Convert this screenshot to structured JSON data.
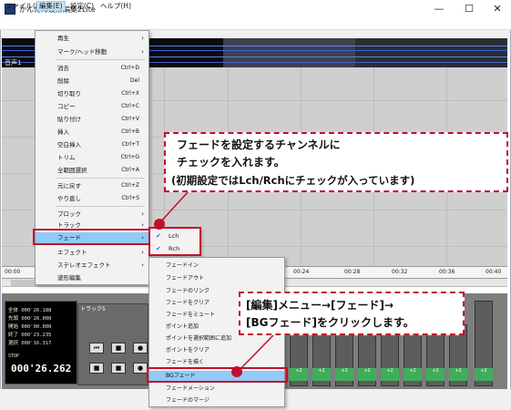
{
  "window": {
    "title": "かんたん波形編集2Lite",
    "min": "—",
    "max": "☐",
    "close": "✕"
  },
  "menubar": [
    "ファイル(F)",
    "編集(E)",
    "設定(C)",
    "ヘルプ(H)"
  ],
  "track_label_upper": "音声1",
  "edit_menu": [
    {
      "label": "再生",
      "shortcut": "",
      "submenu": true
    },
    {
      "label": "マーク/ヘッド移動",
      "shortcut": "",
      "submenu": true
    },
    {
      "label": "消去",
      "shortcut": "Ctrl+D"
    },
    {
      "label": "削除",
      "shortcut": "Del"
    },
    {
      "label": "切り取り",
      "shortcut": "Ctrl+X"
    },
    {
      "label": "コピー",
      "shortcut": "Ctrl+C"
    },
    {
      "label": "貼り付け",
      "shortcut": "Ctrl+V"
    },
    {
      "label": "挿入",
      "shortcut": "Ctrl+B"
    },
    {
      "label": "空白挿入",
      "shortcut": "Ctrl+T"
    },
    {
      "label": "トリム",
      "shortcut": "Ctrl+G"
    },
    {
      "label": "全範囲選択",
      "shortcut": "Ctrl+A"
    },
    {
      "label": "元に戻す",
      "shortcut": "Ctrl+Z"
    },
    {
      "label": "やり直し",
      "shortcut": "Ctrl+S"
    },
    {
      "label": "ブロック",
      "shortcut": "",
      "submenu": true
    },
    {
      "label": "トラック",
      "shortcut": "",
      "submenu": true
    },
    {
      "label": "フェード",
      "shortcut": "",
      "submenu": true
    },
    {
      "label": "エフェクト",
      "shortcut": "",
      "submenu": true
    },
    {
      "label": "ステレオエフェクト",
      "shortcut": "",
      "submenu": true
    },
    {
      "label": "波形編集",
      "shortcut": ""
    }
  ],
  "channel_menu": [
    "Lch",
    "Rch"
  ],
  "fade_menu": [
    "フェードイン",
    "フェードアウト",
    "フェードのリンク",
    "フェードをクリア",
    "フェードをミュート",
    "ポイント追加",
    "ポイントを選択範囲に追加",
    "ポイントをクリア",
    "フェードを描く",
    "BGフェード",
    "フェードメーション",
    "フェードのマージ"
  ],
  "ruler_ticks": [
    "00:00",
    "00:24",
    "00:28",
    "00:32",
    "00:36",
    "00:40"
  ],
  "time_panel": {
    "lines": [
      {
        "k": "全体",
        "v": "000'26.188"
      },
      {
        "k": "先頭",
        "v": "000'26.000"
      },
      {
        "k": "開始",
        "v": "000'00.000"
      },
      {
        "k": "終了",
        "v": "000'23.235"
      },
      {
        "k": "選択",
        "v": "000'16.317"
      }
    ],
    "state": "STOP",
    "current": "000'26.262"
  },
  "track_panel_label": "トラック5",
  "mixer_label": "+2",
  "callout1": {
    "lines": [
      "フェードを設定するチャンネルに",
      "チェックを入れます。",
      "(初期設定ではLch/Rchにチェックが入っています)"
    ]
  },
  "callout2": {
    "lines": [
      "[編集]メニュー→[フェード]→",
      "[BGフェード]をクリックします。"
    ]
  },
  "colors": {
    "highlight": "#91c9f7",
    "callout_red": "#c0102a",
    "wave": "#5a7fe0"
  }
}
